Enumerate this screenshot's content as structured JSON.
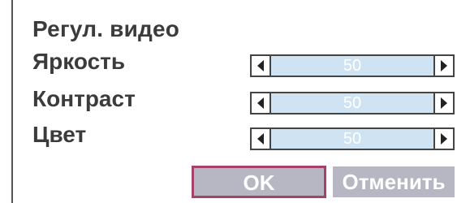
{
  "dialog": {
    "title": "Регул. видео",
    "rows": [
      {
        "label": "Яркость",
        "value": "50",
        "level": 50
      },
      {
        "label": "Контраст",
        "value": "50",
        "level": 50
      },
      {
        "label": "Цвет",
        "value": "50",
        "level": 50
      }
    ],
    "buttons": {
      "ok": "OK",
      "cancel": "Отменить"
    }
  },
  "colors": {
    "track": "#cfe3f3",
    "button": "#b6b7c2",
    "focus_border": "#a4436a",
    "text": "#3b3b3b"
  },
  "icons": {
    "decrease": "triangle-left-icon",
    "increase": "triangle-right-icon"
  }
}
